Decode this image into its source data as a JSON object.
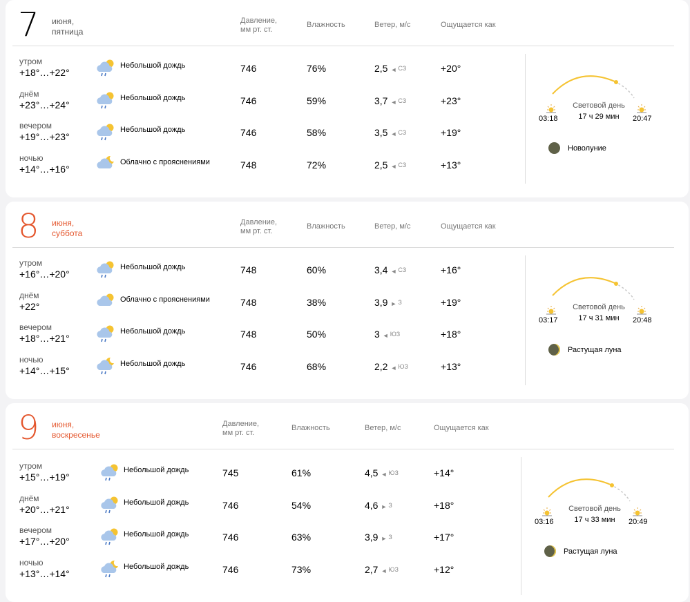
{
  "headers": {
    "pressure": "Давление,\nмм рт. ст.",
    "humidity": "Влажность",
    "wind": "Ветер, м/с",
    "feels": "Ощущается как"
  },
  "days": [
    {
      "num": "7",
      "weekday_line1": "июня,",
      "weekday_line2": "пятница",
      "weekend": false,
      "rows": [
        {
          "part": "утром",
          "temp": "+18°…+22°",
          "icon": "cloud-sun-rain-icon",
          "cond": "Небольшой дождь",
          "pressure": "746",
          "humidity": "76%",
          "wind": "2,5",
          "dir": "СЗ",
          "dir_arrow": "◄",
          "feels": "+20°"
        },
        {
          "part": "днём",
          "temp": "+23°…+24°",
          "icon": "cloud-sun-rain-icon",
          "cond": "Небольшой дождь",
          "pressure": "746",
          "humidity": "59%",
          "wind": "3,7",
          "dir": "СЗ",
          "dir_arrow": "◄",
          "feels": "+23°"
        },
        {
          "part": "вечером",
          "temp": "+19°…+23°",
          "icon": "cloud-sun-rain-icon",
          "cond": "Небольшой дождь",
          "pressure": "746",
          "humidity": "58%",
          "wind": "3,5",
          "dir": "СЗ",
          "dir_arrow": "◄",
          "feels": "+19°"
        },
        {
          "part": "ночью",
          "temp": "+14°…+16°",
          "icon": "cloud-moon-icon",
          "cond": "Облачно с прояснениями",
          "pressure": "748",
          "humidity": "72%",
          "wind": "2,5",
          "dir": "СЗ",
          "dir_arrow": "◄",
          "feels": "+13°"
        }
      ],
      "sunrise": "03:18",
      "sunset": "20:47",
      "daylight_label": "Световой день",
      "daylight": "17 ч 29 мин",
      "moon": "Новолуние",
      "moon_phase": "new"
    },
    {
      "num": "8",
      "weekday_line1": "июня,",
      "weekday_line2": "суббота",
      "weekend": true,
      "rows": [
        {
          "part": "утром",
          "temp": "+16°…+20°",
          "icon": "cloud-sun-rain-icon",
          "cond": "Небольшой дождь",
          "pressure": "748",
          "humidity": "60%",
          "wind": "3,4",
          "dir": "СЗ",
          "dir_arrow": "◄",
          "feels": "+16°"
        },
        {
          "part": "днём",
          "temp": "+22°",
          "icon": "cloud-sun-icon",
          "cond": "Облачно с прояснениями",
          "pressure": "748",
          "humidity": "38%",
          "wind": "3,9",
          "dir": "З",
          "dir_arrow": "►",
          "feels": "+19°"
        },
        {
          "part": "вечером",
          "temp": "+18°…+21°",
          "icon": "cloud-sun-rain-icon",
          "cond": "Небольшой дождь",
          "pressure": "748",
          "humidity": "50%",
          "wind": "3",
          "dir": "ЮЗ",
          "dir_arrow": "◄",
          "feels": "+18°"
        },
        {
          "part": "ночью",
          "temp": "+14°…+15°",
          "icon": "cloud-moon-rain-icon",
          "cond": "Небольшой дождь",
          "pressure": "746",
          "humidity": "68%",
          "wind": "2,2",
          "dir": "ЮЗ",
          "dir_arrow": "◄",
          "feels": "+13°"
        }
      ],
      "sunrise": "03:17",
      "sunset": "20:48",
      "daylight_label": "Световой день",
      "daylight": "17 ч 31 мин",
      "moon": "Растущая луна",
      "moon_phase": "waxing"
    },
    {
      "num": "9",
      "weekday_line1": "июня,",
      "weekday_line2": "воскресенье",
      "weekend": true,
      "rows": [
        {
          "part": "утром",
          "temp": "+15°…+19°",
          "icon": "cloud-sun-rain-icon",
          "cond": "Небольшой дождь",
          "pressure": "745",
          "humidity": "61%",
          "wind": "4,5",
          "dir": "ЮЗ",
          "dir_arrow": "◄",
          "feels": "+14°"
        },
        {
          "part": "днём",
          "temp": "+20°…+21°",
          "icon": "cloud-sun-rain-icon",
          "cond": "Небольшой дождь",
          "pressure": "746",
          "humidity": "54%",
          "wind": "4,6",
          "dir": "З",
          "dir_arrow": "►",
          "feels": "+18°"
        },
        {
          "part": "вечером",
          "temp": "+17°…+20°",
          "icon": "cloud-sun-rain-icon",
          "cond": "Небольшой дождь",
          "pressure": "746",
          "humidity": "63%",
          "wind": "3,9",
          "dir": "З",
          "dir_arrow": "►",
          "feels": "+17°"
        },
        {
          "part": "ночью",
          "temp": "+13°…+14°",
          "icon": "cloud-moon-rain-icon",
          "cond": "Небольшой дождь",
          "pressure": "746",
          "humidity": "73%",
          "wind": "2,7",
          "dir": "ЮЗ",
          "dir_arrow": "◄",
          "feels": "+12°"
        }
      ],
      "sunrise": "03:16",
      "sunset": "20:49",
      "daylight_label": "Световой день",
      "daylight": "17 ч 33 мин",
      "moon": "Растущая луна",
      "moon_phase": "waxing"
    }
  ]
}
